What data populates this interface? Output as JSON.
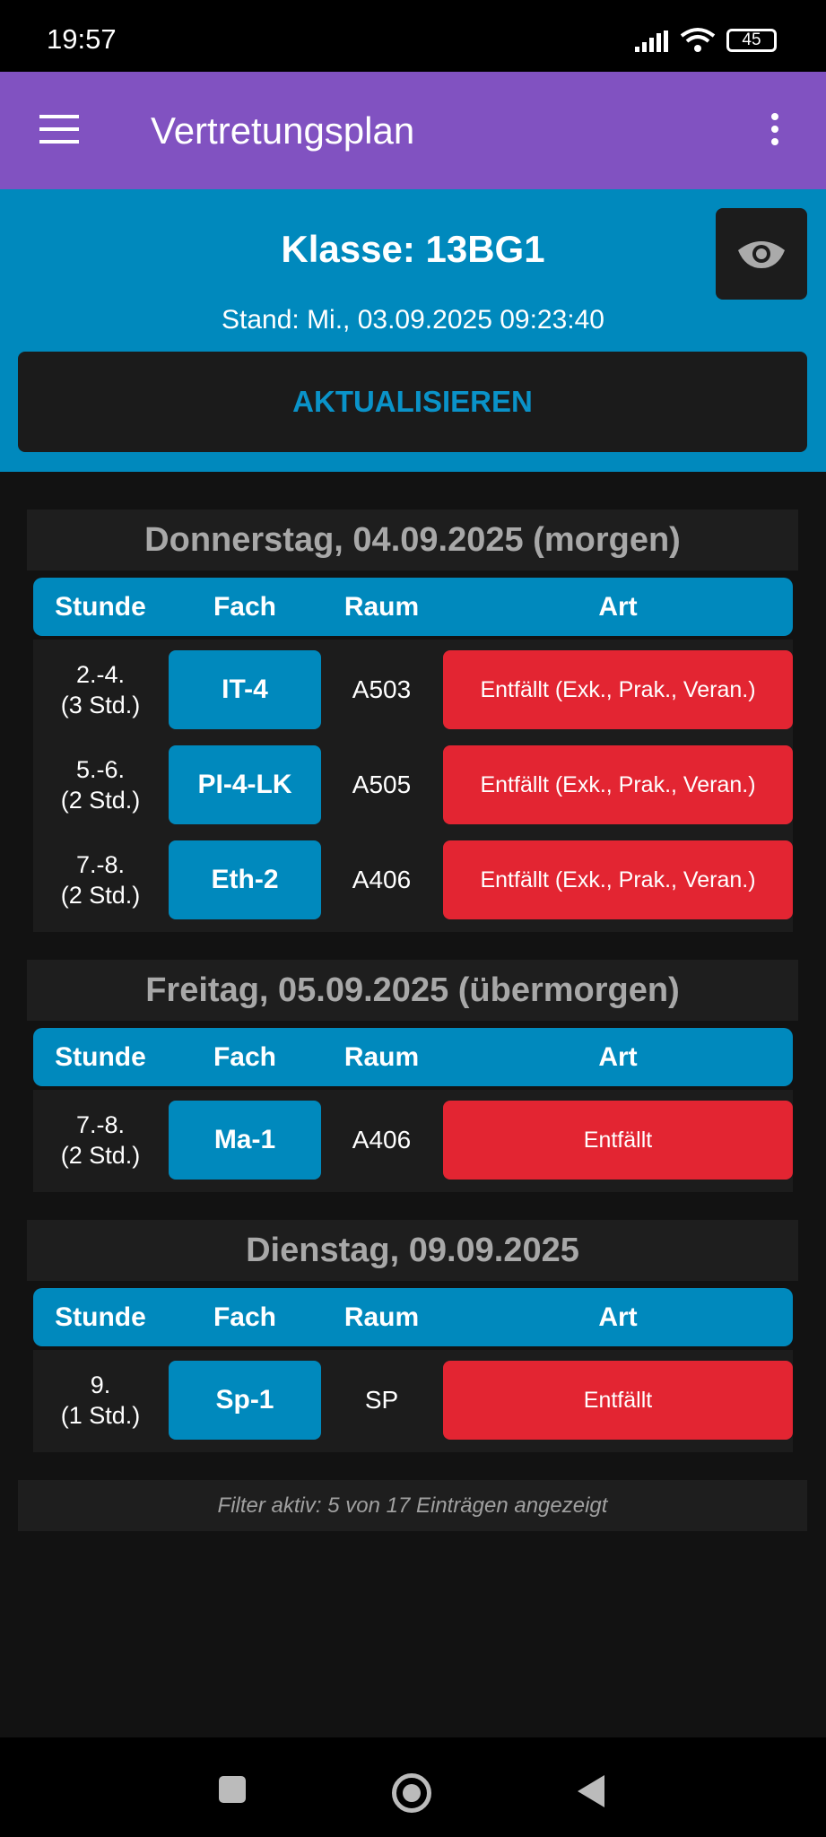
{
  "status_bar": {
    "time": "19:57",
    "battery": "45"
  },
  "app_bar": {
    "title": "Vertretungsplan"
  },
  "header": {
    "klasse": "Klasse: 13BG1",
    "stand": "Stand: Mi., 03.09.2025 09:23:40",
    "refresh_label": "AKTUALISIEREN"
  },
  "columns": {
    "stunde": "Stunde",
    "fach": "Fach",
    "raum": "Raum",
    "art": "Art"
  },
  "days": [
    {
      "title": "Donnerstag, 04.09.2025 (morgen)",
      "rows": [
        {
          "stunde": "2.-4.",
          "dauer": "(3 Std.)",
          "fach": "IT-4",
          "raum": "A503",
          "art": "Entfällt (Exk., Prak., Veran.)"
        },
        {
          "stunde": "5.-6.",
          "dauer": "(2 Std.)",
          "fach": "PI-4-LK",
          "raum": "A505",
          "art": "Entfällt (Exk., Prak., Veran.)"
        },
        {
          "stunde": "7.-8.",
          "dauer": "(2 Std.)",
          "fach": "Eth-2",
          "raum": "A406",
          "art": "Entfällt (Exk., Prak., Veran.)"
        }
      ]
    },
    {
      "title": "Freitag, 05.09.2025 (übermorgen)",
      "rows": [
        {
          "stunde": "7.-8.",
          "dauer": "(2 Std.)",
          "fach": "Ma-1",
          "raum": "A406",
          "art": "Entfällt"
        }
      ]
    },
    {
      "title": "Dienstag, 09.09.2025",
      "rows": [
        {
          "stunde": "9.",
          "dauer": "(1 Std.)",
          "fach": "Sp-1",
          "raum": "SP",
          "art": "Entfällt"
        }
      ]
    }
  ],
  "filter_text": "Filter aktiv: 5 von 17 Einträgen angezeigt",
  "colors": {
    "app_bar": "#8152c1",
    "header": "#0089bd",
    "cancel": "#e32532"
  }
}
